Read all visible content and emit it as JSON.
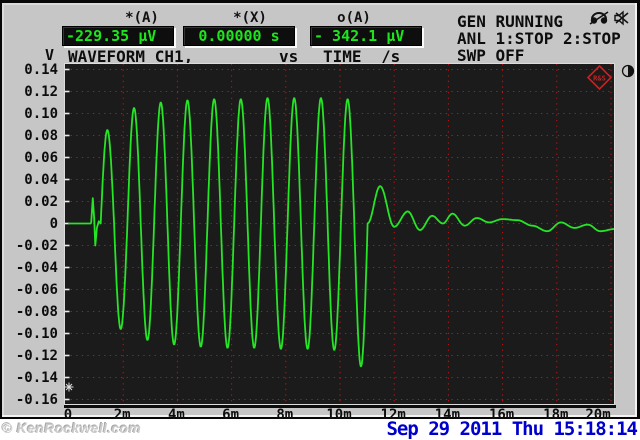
{
  "header": {
    "cursors": [
      {
        "label": "*(A)",
        "value": "-229.35 µV"
      },
      {
        "label": "*(X)",
        "value": "0.00000 s"
      },
      {
        "label": "o(A)",
        "value": "- 342.1 µV"
      }
    ],
    "status": {
      "gen": "GEN RUNNING",
      "anl": "ANL 1:STOP 2:STOP",
      "swp": "SWP OFF"
    },
    "icons": [
      "headphone-muted",
      "speaker-muted"
    ]
  },
  "plot_header": {
    "y_unit": "V",
    "trace_label": "WAVEFORM CH1,",
    "vs_label": "vs",
    "x_quantity": "TIME",
    "x_unit": "/s"
  },
  "footer": {
    "watermark": "© KenRockwell.com",
    "datetime": "Sep 29 2011 Thu 15:18:14"
  },
  "colors": {
    "chrome": "#c6c6c6",
    "lcd-bg": "#0e0e0e",
    "green": "#1ce51c",
    "plot-bg": "#1b1b1b",
    "grid": "#c61212",
    "trace": "#26e426",
    "logo": "#c52222",
    "blue": "#0000cd",
    "wm": "#cccccc"
  },
  "chart_data": {
    "type": "line",
    "title": "WAVEFORM CH1, vs TIME /s",
    "xlabel": "TIME /s",
    "ylabel": "V",
    "xlim_ms": [
      0,
      20
    ],
    "ylim": [
      -0.16,
      0.14
    ],
    "grid": "red-dotted",
    "x_tick_values_ms": [
      0,
      2,
      4,
      6,
      8,
      10,
      12,
      14,
      16,
      18,
      20
    ],
    "x_tick_labels": [
      "0",
      "2m",
      "4m",
      "6m",
      "8m",
      "10m",
      "12m",
      "14m",
      "16m",
      "18m",
      "20m"
    ],
    "y_ticks": [
      0.14,
      0.12,
      0.1,
      0.08,
      0.06,
      0.04,
      0.02,
      0,
      -0.02,
      -0.04,
      -0.06,
      -0.08,
      -0.1,
      -0.12,
      -0.14,
      -0.16
    ],
    "y_tick_labels": [
      "0.14",
      "0.12",
      "0.10",
      "0.08",
      "0.06",
      "0.04",
      "0.02",
      "0",
      "-0.02",
      "-0.04",
      "-0.06",
      "-0.08",
      "-0.10",
      "-0.12",
      "-0.14",
      "-0.16"
    ],
    "series": [
      {
        "name": "CH1",
        "model": "tone-burst-with-ringdown",
        "frequency_hz": 1000,
        "period_ms": 0.985,
        "burst_start_ms": 1.17,
        "burst_cycles": 10,
        "glitch_keypoints_ms_v": [
          [
            0.82,
            0.001
          ],
          [
            0.88,
            0.023
          ],
          [
            0.93,
            0.004
          ],
          [
            0.97,
            -0.02
          ],
          [
            1.03,
            -0.004
          ],
          [
            1.1,
            0.002
          ],
          [
            1.17,
            0
          ]
        ],
        "positive_peaks": [
          0.085,
          0.105,
          0.11,
          0.112,
          0.113,
          0.113,
          0.114,
          0.114,
          0.114,
          0.113
        ],
        "negative_peaks": [
          -0.096,
          -0.106,
          -0.11,
          -0.112,
          -0.113,
          -0.113,
          -0.114,
          -0.114,
          -0.115,
          -0.13
        ],
        "tail_keypoints_ms_v": [
          [
            11.02,
            0
          ],
          [
            11.48,
            0.034
          ],
          [
            12.0,
            -0.003
          ],
          [
            12.5,
            0.011
          ],
          [
            12.95,
            -0.006
          ],
          [
            13.4,
            0.007
          ],
          [
            13.8,
            0.0
          ],
          [
            14.15,
            0.009
          ],
          [
            14.6,
            -0.002
          ],
          [
            15.05,
            0.005
          ],
          [
            15.5,
            0.001
          ],
          [
            16.0,
            0.004
          ],
          [
            16.55,
            0.003
          ],
          [
            17.1,
            -0.002
          ],
          [
            17.65,
            -0.007
          ],
          [
            18.15,
            0.001
          ],
          [
            18.65,
            -0.004
          ],
          [
            19.15,
            -0.001
          ],
          [
            19.6,
            -0.007
          ],
          [
            20.15,
            -0.005
          ]
        ]
      }
    ]
  }
}
